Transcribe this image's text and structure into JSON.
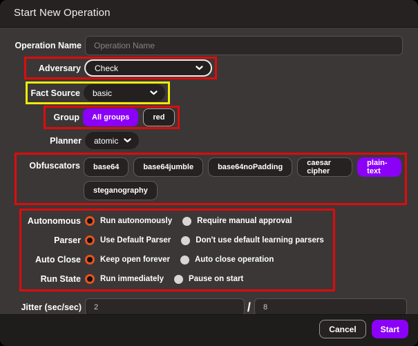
{
  "dialog": {
    "title": "Start New Operation",
    "fields": {
      "operation_name": {
        "label": "Operation Name",
        "placeholder": "Operation Name",
        "value": ""
      },
      "adversary": {
        "label": "Adversary",
        "value": "Check"
      },
      "fact_source": {
        "label": "Fact Source",
        "value": "basic"
      },
      "group": {
        "label": "Group",
        "options": [
          {
            "label": "All groups",
            "selected": true
          },
          {
            "label": "red",
            "selected": false
          }
        ]
      },
      "planner": {
        "label": "Planner",
        "value": "atomic"
      },
      "obfuscators": {
        "label": "Obfuscators",
        "options": [
          {
            "label": "base64",
            "selected": false
          },
          {
            "label": "base64jumble",
            "selected": false
          },
          {
            "label": "base64noPadding",
            "selected": false
          },
          {
            "label": "caesar cipher",
            "selected": false
          },
          {
            "label": "plain-text",
            "selected": true
          },
          {
            "label": "steganography",
            "selected": false
          }
        ]
      },
      "autonomous": {
        "label": "Autonomous",
        "options": [
          {
            "label": "Run autonomously",
            "selected": true
          },
          {
            "label": "Require manual approval",
            "selected": false
          }
        ]
      },
      "parser": {
        "label": "Parser",
        "options": [
          {
            "label": "Use Default Parser",
            "selected": true
          },
          {
            "label": "Don't use default learning parsers",
            "selected": false
          }
        ]
      },
      "auto_close": {
        "label": "Auto Close",
        "options": [
          {
            "label": "Keep open forever",
            "selected": true
          },
          {
            "label": "Auto close operation",
            "selected": false
          }
        ]
      },
      "run_state": {
        "label": "Run State",
        "options": [
          {
            "label": "Run immediately",
            "selected": true
          },
          {
            "label": "Pause on start",
            "selected": false
          }
        ]
      },
      "jitter": {
        "label": "Jitter (sec/sec)",
        "fraction_value": "2",
        "separator": "/",
        "fraction_total": "8"
      }
    },
    "footer": {
      "cancel_label": "Cancel",
      "start_label": "Start"
    }
  },
  "icons": {
    "select_chevron": "chevron-down-icon"
  },
  "colors": {
    "accent_purple": "#8b00f6",
    "radio_selected_orange": "#e8531d",
    "annotation_red": "#e00b0b",
    "annotation_yellow": "#f2ea0a",
    "dialog_body_bg": "#3b3737",
    "dialog_header_bg": "#262222",
    "dialog_footer_bg": "#1f1c1c"
  }
}
